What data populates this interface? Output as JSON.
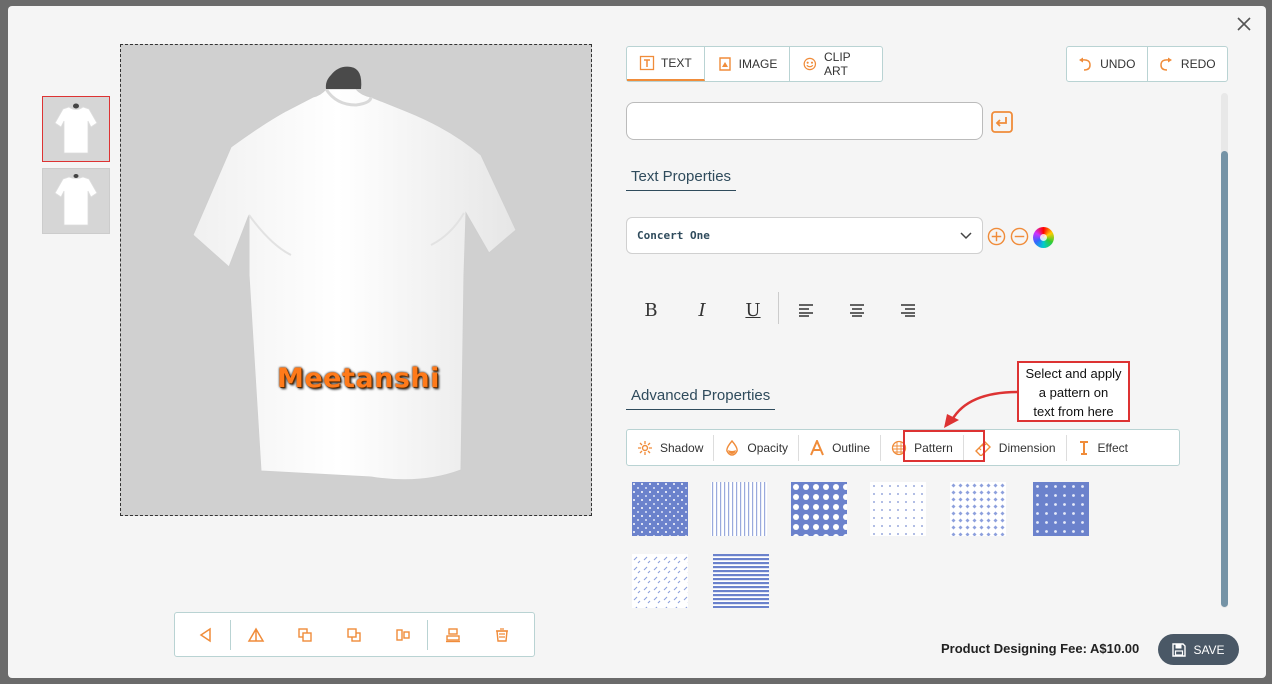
{
  "design_text": "Meetanshi",
  "tabs": [
    {
      "label": "TEXT",
      "icon": "text-icon",
      "active": true
    },
    {
      "label": "IMAGE",
      "icon": "image-icon",
      "active": false
    },
    {
      "label": "CLIP ART",
      "icon": "clipart-icon",
      "active": false
    }
  ],
  "history": {
    "undo_label": "UNDO",
    "redo_label": "REDO"
  },
  "text_input": {
    "value": "",
    "placeholder": ""
  },
  "text_properties": {
    "heading": "Text Properties",
    "font_value": "Concert One",
    "format_buttons": [
      "B",
      "I",
      "U"
    ]
  },
  "advanced": {
    "heading": "Advanced Properties",
    "tabs": [
      {
        "label": "Shadow",
        "icon": "sun-icon"
      },
      {
        "label": "Opacity",
        "icon": "drop-icon"
      },
      {
        "label": "Outline",
        "icon": "outline-a-icon"
      },
      {
        "label": "Pattern",
        "icon": "pattern-icon"
      },
      {
        "label": "Dimension",
        "icon": "ruler-icon"
      },
      {
        "label": "Effect",
        "icon": "effect-icon"
      }
    ]
  },
  "callout": {
    "line1": "Select and apply",
    "line2": "a pattern on",
    "line3": "text from here"
  },
  "footer": {
    "fee": "Product Designing Fee: A$10.00",
    "save_label": "SAVE"
  },
  "colors": {
    "accent": "#f08c3a",
    "pattern_blue": "#6b82cc",
    "save_bg": "#4a5866",
    "highlight_red": "#dd3333"
  }
}
